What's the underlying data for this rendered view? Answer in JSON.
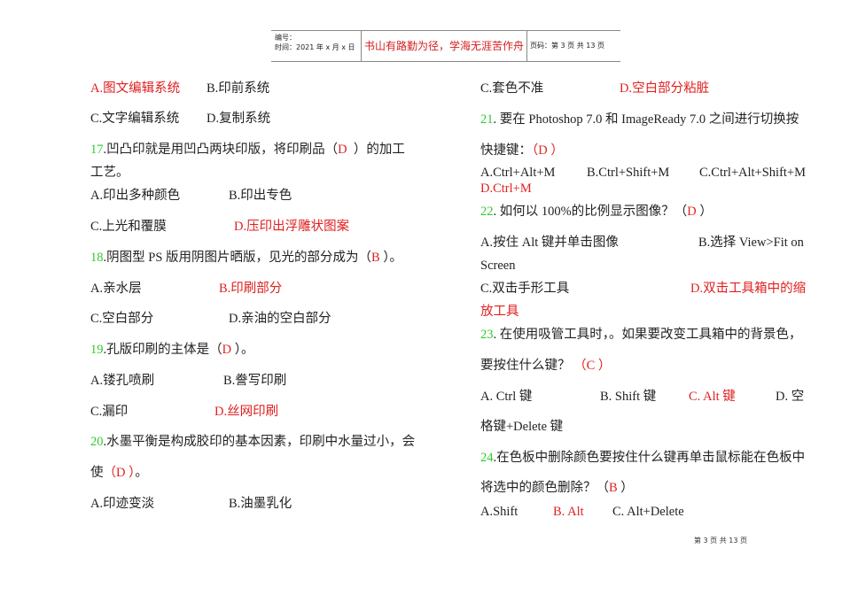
{
  "header": {
    "number_label": "编号：",
    "time_label": "时间：2021 年 x 月 x 日",
    "motto": "书山有路勤为径，学海无涯苦作舟",
    "page_info": "页码：第 3 页  共 13 页"
  },
  "colors": {
    "answer": "#e02020",
    "number": "#2ecc2e",
    "text": "#222222"
  },
  "lines": [
    [
      {
        "t": "A.图文编辑系统",
        "c": "red"
      }
    ],
    [
      {
        "t": "B.印前系统",
        "c": "black"
      }
    ],
    [
      {
        "t": "C.文字编辑系统",
        "c": "black"
      }
    ],
    [
      {
        "t": "D.复制系统",
        "c": "black"
      }
    ],
    [
      {
        "t": "17",
        "c": "green"
      },
      {
        "t": ".凹凸印就是用凹凸两块印版，将印刷品（",
        "c": "black"
      },
      {
        "t": "D",
        "c": "red"
      },
      {
        "t": "  ）的加工",
        "c": "black"
      }
    ],
    [
      {
        "t": "工艺。",
        "c": "black"
      }
    ],
    [
      {
        "t": "A.印出多种颜色",
        "c": "black"
      }
    ],
    [
      {
        "t": "B.印出专色",
        "c": "black"
      }
    ],
    [
      {
        "t": "C.上光和覆膜",
        "c": "black"
      }
    ],
    [
      {
        "t": "D.压印出浮雕状图案",
        "c": "red"
      }
    ],
    [
      {
        "t": "18",
        "c": "green"
      },
      {
        "t": ".阴图型 PS 版用阴图片晒版，见光的部分成为（",
        "c": "black"
      },
      {
        "t": "B",
        "c": "red"
      },
      {
        "t": " ）。",
        "c": "black"
      }
    ],
    [
      {
        "t": "A.亲水层",
        "c": "black"
      }
    ],
    [
      {
        "t": "B.印刷部分",
        "c": "red"
      }
    ],
    [
      {
        "t": "C.空白部分",
        "c": "black"
      }
    ],
    [
      {
        "t": "D.亲油的空白部分",
        "c": "black"
      }
    ],
    [
      {
        "t": "19",
        "c": "green"
      },
      {
        "t": ".孔版印刷的主体是（",
        "c": "black"
      },
      {
        "t": "D",
        "c": "red"
      },
      {
        "t": " ）。",
        "c": "black"
      }
    ],
    [
      {
        "t": "A.镂孔喷刷",
        "c": "black"
      }
    ],
    [
      {
        "t": "B.誊写印刷",
        "c": "black"
      }
    ],
    [
      {
        "t": "C.漏印",
        "c": "black"
      }
    ],
    [
      {
        "t": "D.丝网印刷",
        "c": "red"
      }
    ],
    [
      {
        "t": "20",
        "c": "green"
      },
      {
        "t": ".水墨平衡是构成胶印的基本因素，印刷中水量过小，会",
        "c": "black"
      }
    ],
    [
      {
        "t": "使",
        "c": "black"
      },
      {
        "t": "（D ）",
        "c": "red"
      },
      {
        "t": "。",
        "c": "black"
      }
    ],
    [
      {
        "t": "A.印迹变淡",
        "c": "black"
      }
    ],
    [
      {
        "t": "B.油墨乳化",
        "c": "black"
      }
    ],
    [
      {
        "t": "C.套色不准",
        "c": "black"
      }
    ],
    [
      {
        "t": "D.空白部分粘脏",
        "c": "red"
      }
    ],
    [
      {
        "t": "21",
        "c": "green"
      },
      {
        "t": ". 要在 Photoshop 7.0 和 ImageReady 7.0 之间进行切换按",
        "c": "black"
      }
    ],
    [
      {
        "t": "快捷键：",
        "c": "black"
      },
      {
        "t": "（D ）",
        "c": "red"
      }
    ],
    [
      {
        "t": "A.Ctrl+Alt+M",
        "c": "black"
      }
    ],
    [
      {
        "t": "B.Ctrl+Shift+M",
        "c": "black"
      }
    ],
    [
      {
        "t": "C.Ctrl+Alt+Shift+M",
        "c": "black"
      }
    ],
    [
      {
        "t": "D.Ctrl+M",
        "c": "red"
      }
    ],
    [
      {
        "t": "22",
        "c": "green"
      },
      {
        "t": ". 如何以 100%的比例显示图像？（",
        "c": "black"
      },
      {
        "t": "D",
        "c": "red"
      },
      {
        "t": " ）",
        "c": "black"
      }
    ],
    [
      {
        "t": "A.按住 Alt 键并单击图像",
        "c": "black"
      }
    ],
    [
      {
        "t": "B.选择 View>Fit on",
        "c": "black"
      }
    ],
    [
      {
        "t": "Screen",
        "c": "black"
      }
    ],
    [
      {
        "t": "C.双击手形工具",
        "c": "black"
      }
    ],
    [
      {
        "t": "D.双击工具箱中的缩",
        "c": "red"
      }
    ],
    [
      {
        "t": "放工具",
        "c": "red"
      }
    ],
    [
      {
        "t": "23",
        "c": "green"
      },
      {
        "t": ". 在使用吸管工具时，。如果要改变工具箱中的背景色，",
        "c": "black"
      }
    ],
    [
      {
        "t": "要按住什么键？ ",
        "c": "black"
      },
      {
        "t": "（C ）",
        "c": "red"
      }
    ],
    [
      {
        "t": "A. Ctrl 键",
        "c": "black"
      }
    ],
    [
      {
        "t": "B. Shift 键",
        "c": "black"
      }
    ],
    [
      {
        "t": "C. Alt 键",
        "c": "red"
      }
    ],
    [
      {
        "t": "D. 空",
        "c": "black"
      }
    ],
    [
      {
        "t": "格键+Delete 键",
        "c": "black"
      }
    ],
    [
      {
        "t": "24",
        "c": "green"
      },
      {
        "t": ".在色板中删除颜色要按住什么键再单击鼠标能在色板中",
        "c": "black"
      }
    ],
    [
      {
        "t": "将选中的颜色删除？（",
        "c": "black"
      },
      {
        "t": "B",
        "c": "red"
      },
      {
        "t": " ）",
        "c": "black"
      }
    ],
    [
      {
        "t": "A.Shift",
        "c": "black"
      }
    ],
    [
      {
        "t": "B. Alt",
        "c": "red"
      }
    ],
    [
      {
        "t": "C. Alt+Delete",
        "c": "black"
      }
    ]
  ],
  "footer": {
    "page": "第 3 页  共 13 页"
  }
}
